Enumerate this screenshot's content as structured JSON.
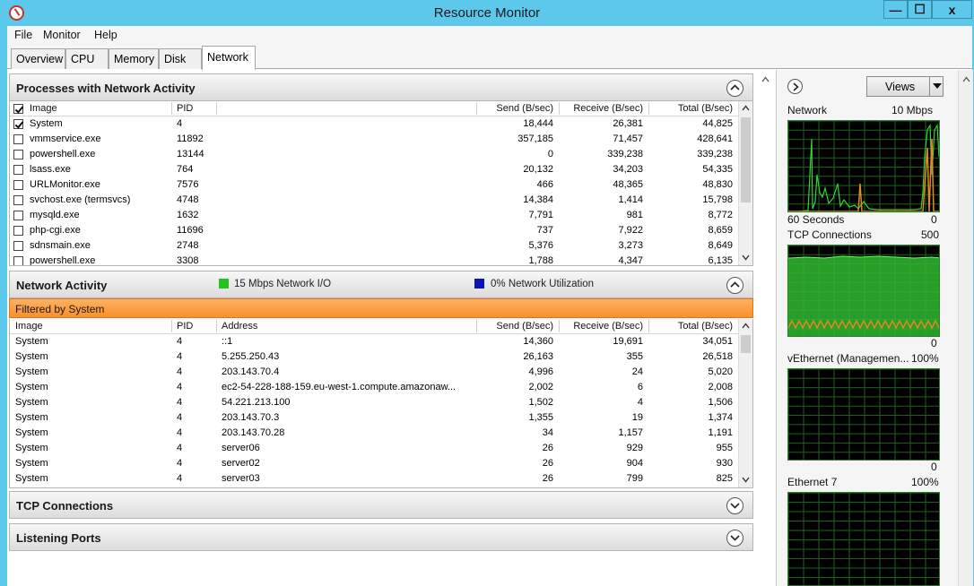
{
  "window": {
    "title": "Resource Monitor",
    "min": "—",
    "max": "☐",
    "close": "x"
  },
  "menu": [
    "File",
    "Monitor",
    "Help"
  ],
  "tabs": [
    "Overview",
    "CPU",
    "Memory",
    "Disk",
    "Network"
  ],
  "processes": {
    "title": "Processes with Network Activity",
    "columns": [
      "Image",
      "PID",
      "Send (B/sec)",
      "Receive (B/sec)",
      "Total (B/sec)"
    ],
    "rows": [
      {
        "checked": true,
        "image": "System",
        "pid": "4",
        "send": "18,444",
        "receive": "26,381",
        "total": "44,825"
      },
      {
        "checked": false,
        "image": "vmmservice.exe",
        "pid": "11892",
        "send": "357,185",
        "receive": "71,457",
        "total": "428,641"
      },
      {
        "checked": false,
        "image": "powershell.exe",
        "pid": "13144",
        "send": "0",
        "receive": "339,238",
        "total": "339,238"
      },
      {
        "checked": false,
        "image": "lsass.exe",
        "pid": "764",
        "send": "20,132",
        "receive": "34,203",
        "total": "54,335"
      },
      {
        "checked": false,
        "image": "URLMonitor.exe",
        "pid": "7576",
        "send": "466",
        "receive": "48,365",
        "total": "48,830"
      },
      {
        "checked": false,
        "image": "svchost.exe (termsvcs)",
        "pid": "4748",
        "send": "14,384",
        "receive": "1,414",
        "total": "15,798"
      },
      {
        "checked": false,
        "image": "mysqld.exe",
        "pid": "1632",
        "send": "7,791",
        "receive": "981",
        "total": "8,772"
      },
      {
        "checked": false,
        "image": "php-cgi.exe",
        "pid": "11696",
        "send": "737",
        "receive": "7,922",
        "total": "8,659"
      },
      {
        "checked": false,
        "image": "sdnsmain.exe",
        "pid": "2748",
        "send": "5,376",
        "receive": "3,273",
        "total": "8,649"
      },
      {
        "checked": false,
        "image": "powershell.exe",
        "pid": "3308",
        "send": "1,788",
        "receive": "4,347",
        "total": "6,135"
      }
    ]
  },
  "network": {
    "title": "Network Activity",
    "io_legend": "15 Mbps Network I/O",
    "util_legend": "0% Network Utilization",
    "io_color": "#22c322",
    "util_color": "#0a14b4",
    "filter": "Filtered by System",
    "columns": [
      "Image",
      "PID",
      "Address",
      "Send (B/sec)",
      "Receive (B/sec)",
      "Total (B/sec)"
    ],
    "rows": [
      {
        "image": "System",
        "pid": "4",
        "address": "::1",
        "send": "14,360",
        "receive": "19,691",
        "total": "34,051"
      },
      {
        "image": "System",
        "pid": "4",
        "address": "5.255.250.43",
        "send": "26,163",
        "receive": "355",
        "total": "26,518"
      },
      {
        "image": "System",
        "pid": "4",
        "address": "203.143.70.4",
        "send": "4,996",
        "receive": "24",
        "total": "5,020"
      },
      {
        "image": "System",
        "pid": "4",
        "address": "ec2-54-228-188-159.eu-west-1.compute.amazonaw...",
        "send": "2,002",
        "receive": "6",
        "total": "2,008"
      },
      {
        "image": "System",
        "pid": "4",
        "address": "54.221.213.100",
        "send": "1,502",
        "receive": "4",
        "total": "1,506"
      },
      {
        "image": "System",
        "pid": "4",
        "address": "203.143.70.3",
        "send": "1,355",
        "receive": "19",
        "total": "1,374"
      },
      {
        "image": "System",
        "pid": "4",
        "address": "203.143.70.28",
        "send": "34",
        "receive": "1,157",
        "total": "1,191"
      },
      {
        "image": "System",
        "pid": "4",
        "address": "server06",
        "send": "26",
        "receive": "929",
        "total": "955"
      },
      {
        "image": "System",
        "pid": "4",
        "address": "server02",
        "send": "26",
        "receive": "904",
        "total": "930"
      },
      {
        "image": "System",
        "pid": "4",
        "address": "server03",
        "send": "26",
        "receive": "799",
        "total": "825"
      }
    ]
  },
  "tcp": {
    "title": "TCP Connections"
  },
  "listening": {
    "title": "Listening Ports"
  },
  "right": {
    "views": "Views",
    "graphs": [
      {
        "name": "Network",
        "max": "10 Mbps",
        "bottom_left": "60 Seconds",
        "bottom_right": "0"
      },
      {
        "name": "TCP Connections",
        "max": "500",
        "bottom_left": "",
        "bottom_right": "0"
      },
      {
        "name": "vEthernet (Managemen...",
        "max": "100%",
        "bottom_left": "",
        "bottom_right": "0"
      },
      {
        "name": "Ethernet 7",
        "max": "100%",
        "bottom_left": "",
        "bottom_right": ""
      }
    ]
  }
}
